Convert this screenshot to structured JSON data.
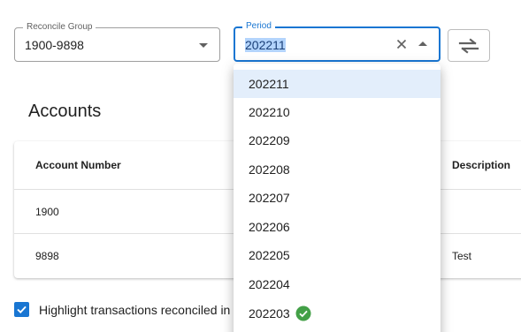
{
  "reconcile_group": {
    "label": "Reconcile Group",
    "value": "1900-9898"
  },
  "period": {
    "label": "Period",
    "value": "202211"
  },
  "accounts": {
    "title": "Accounts",
    "columns": [
      "Account Number",
      "Description"
    ],
    "rows": [
      {
        "account": "1900",
        "description": ""
      },
      {
        "account": "9898",
        "description": "Test"
      }
    ]
  },
  "highlight": {
    "label": "Highlight transactions reconciled in s",
    "checked": true
  },
  "period_options": [
    "202211",
    "202210",
    "202209",
    "202208",
    "202207",
    "202206",
    "202205",
    "202204",
    "202203"
  ],
  "period_option_badge": {
    "index": 8,
    "icon": "check-circle-icon",
    "color": "#43a047"
  },
  "colors": {
    "accent": "#1976d2",
    "success": "#43a047"
  }
}
